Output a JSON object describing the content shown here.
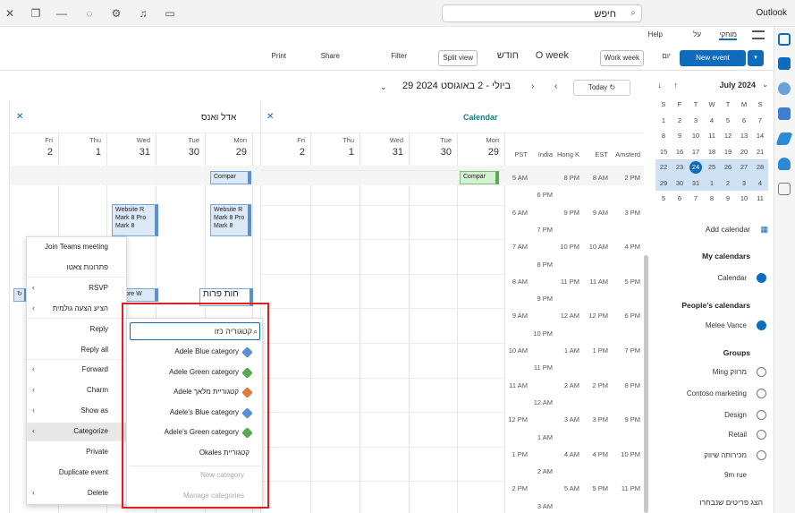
{
  "titlebar": {
    "title": "Outlook",
    "search": "חיפש"
  },
  "tabs": [
    "Help",
    "על",
    "מוחקי"
  ],
  "ribbon": {
    "new_event": "New event",
    "day": "יום",
    "work_week": "Work week",
    "week": "O week",
    "month": "חודש",
    "split_view": "Split view",
    "filter": "Filter",
    "share": "Share",
    "print": "Print"
  },
  "nav": {
    "today": "Today",
    "date_range": "29 ביולי - 2 באוגוסט 2024"
  },
  "mini": {
    "month": "July 2024",
    "days": [
      "S",
      "M",
      "T",
      "W",
      "T",
      "F",
      "S"
    ],
    "weeks": [
      [
        "7",
        "6",
        "5",
        "4",
        "3",
        "2",
        "1"
      ],
      [
        "14",
        "13",
        "12",
        "11",
        "10",
        "9",
        "8"
      ],
      [
        "21",
        "20",
        "19",
        "18",
        "17",
        "16",
        "15"
      ],
      [
        "28",
        "27",
        "26",
        "25",
        "24",
        "23",
        "22"
      ],
      [
        "4",
        "3",
        "2",
        "1",
        "31",
        "30",
        "29"
      ],
      [
        "11",
        "10",
        "9",
        "8",
        "7",
        "6",
        "5"
      ]
    ]
  },
  "left": {
    "add_calendar": "Add calendar",
    "my_cal": "My calendars",
    "calendar": "Calendar",
    "people": "People's calendars",
    "meg": "Melee Vance",
    "groups": "Groups",
    "g1": "Ming מרווק",
    "g2": "Contoso marketing",
    "g3": "Design",
    "g4": "Retail",
    "g5": "מכירותה שיווק",
    "g6": "9m rue",
    "show_more": "הצג פריטים שנבחרו"
  },
  "pane1": {
    "title": "Calendar",
    "days": [
      "Mon",
      "Tue",
      "Wed",
      "Thu",
      "Fri"
    ],
    "nums": [
      "29",
      "30",
      "31",
      "1",
      "2"
    ],
    "tz": [
      "PST",
      "India",
      "Hong K",
      "EST",
      "Amsterd"
    ],
    "times": [
      [
        "5 AM",
        "",
        "8 PM",
        "8 AM",
        "2 PM"
      ],
      [
        "",
        "6 PM",
        "",
        "",
        ""
      ],
      [
        "6 AM",
        "",
        "9 PM",
        "9 AM",
        "3 PM"
      ],
      [
        "",
        "7 PM",
        "",
        "",
        ""
      ],
      [
        "7 AM",
        "",
        "10 PM",
        "10 AM",
        "4 PM"
      ],
      [
        "",
        "8 PM",
        "",
        "",
        ""
      ],
      [
        "8 AM",
        "",
        "11 PM",
        "11 AM",
        "5 PM"
      ],
      [
        "",
        "9 PM",
        "",
        "",
        ""
      ],
      [
        "9 AM",
        "",
        "12 AM",
        "12 PM",
        "6 PM"
      ],
      [
        "",
        "10 PM",
        "",
        "",
        ""
      ],
      [
        "10 AM",
        "",
        "1 AM",
        "1 PM",
        "7 PM"
      ],
      [
        "",
        "11 PM",
        "",
        "",
        ""
      ],
      [
        "11 AM",
        "",
        "2 AM",
        "2 PM",
        "8 PM"
      ],
      [
        "",
        "12 AM",
        "",
        "",
        ""
      ],
      [
        "12 PM",
        "",
        "3 AM",
        "3 PM",
        "9 PM"
      ],
      [
        "",
        "1 AM",
        "",
        "",
        ""
      ],
      [
        "1 PM",
        "",
        "4 AM",
        "4 PM",
        "10 PM"
      ],
      [
        "",
        "2 AM",
        "",
        "",
        ""
      ],
      [
        "2 PM",
        "",
        "5 AM",
        "5 PM",
        "11 PM"
      ],
      [
        "",
        "3 AM",
        "",
        "",
        ""
      ]
    ],
    "ev_compar": "Compar"
  },
  "pane2": {
    "title": "אדל ואנס",
    "days": [
      "Mon",
      "Tue",
      "Wed",
      "Thu",
      "Fri"
    ],
    "nums": [
      "29",
      "30",
      "31",
      "1",
      "2"
    ],
    "ev1": "Compar",
    "ev2a": "Website R",
    "ev2b": "Mark 8 Pro",
    "ev2c": "Mark 8",
    "ev3a": "Website R",
    "ev3b": "Mark 8 Pro",
    "ev3c": "Mark 8",
    "ev4": "Core W",
    "ev5": "חות פרות"
  },
  "ctx": {
    "items": [
      "Join Teams meeting",
      "פתרונות צאטו",
      "RSVP",
      "הציע הצעה גולמית",
      "Reply",
      "Reply all",
      "Forward",
      "Charm",
      "Show as",
      "Categorize",
      "Private",
      "Duplicate event",
      "Delete"
    ]
  },
  "sub": {
    "search": "קטגוריה כזו",
    "items": [
      "Adele Blue category",
      "Adele Green category",
      "Adele קטגוריית מלאך",
      "Adele's Blue category",
      "Adele's Green category",
      "Okales קטגוריית"
    ],
    "new": "New category",
    "manage": "Manage categories"
  },
  "colors": {
    "accent": "#0f6cbd",
    "red": "#e02020"
  }
}
